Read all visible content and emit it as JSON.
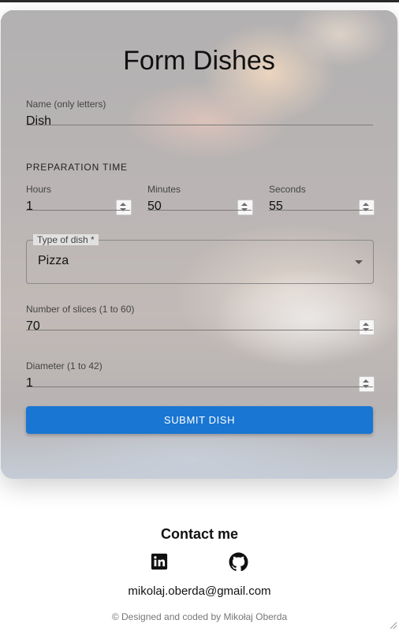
{
  "form": {
    "title": "Form Dishes",
    "name": {
      "label": "Name (only letters)",
      "value": "Dish"
    },
    "preparation": {
      "heading": "PREPARATION TIME",
      "hours": {
        "label": "Hours",
        "value": "1"
      },
      "minutes": {
        "label": "Minutes",
        "value": "50"
      },
      "seconds": {
        "label": "Seconds",
        "value": "55"
      }
    },
    "type": {
      "label": "Type of dish *",
      "value": "Pizza"
    },
    "slices": {
      "label": "Number of slices (1 to 60)",
      "value": "70"
    },
    "diameter": {
      "label": "Diameter (1 to 42)",
      "value": "1"
    },
    "submit_label": "SUBMIT DISH",
    "accent": "#1976d2"
  },
  "footer": {
    "contact_title": "Contact me",
    "email": "mikolaj.oberda@gmail.com",
    "credit": "© Designed and coded by Mikołaj Oberda",
    "icons": [
      "linkedin-icon",
      "github-icon"
    ]
  }
}
